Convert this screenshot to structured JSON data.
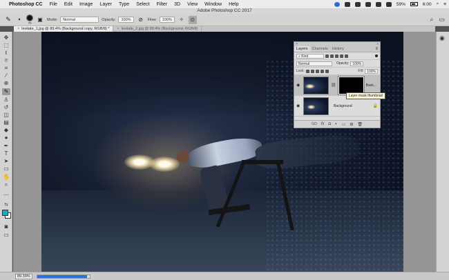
{
  "menubar": {
    "app_name": "Photoshop CC",
    "items": [
      "File",
      "Edit",
      "Image",
      "Layer",
      "Type",
      "Select",
      "Filter",
      "3D",
      "View",
      "Window",
      "Help"
    ],
    "battery": "59%",
    "clock": "6:00"
  },
  "window": {
    "title": "Adobe Photoshop CC 2017"
  },
  "options": {
    "brush_size": "70",
    "mode_label": "Mode:",
    "mode_value": "Normal",
    "opacity_label": "Opacity:",
    "opacity_value": "100%",
    "flow_label": "Flow:",
    "flow_value": "100%"
  },
  "tabs": [
    {
      "label": "levitate_1.jpg @ 89.4% (Background copy, RGB/8) *",
      "active": true
    },
    {
      "label": "levitate_2.jpg @ 89.4% (Background, RGB/8)",
      "active": false
    }
  ],
  "layers_panel": {
    "tabs": [
      "Layers",
      "Channels",
      "History"
    ],
    "filter_value": "Kind",
    "blend_value": "Normal",
    "opacity_label": "Opacity:",
    "opacity_value": "100%",
    "lock_label": "Lock:",
    "fill_label": "Fill:",
    "fill_value": "100%",
    "layers": [
      {
        "name": "Back...",
        "selected": true
      },
      {
        "name": "Background",
        "selected": false
      }
    ],
    "footer": [
      "GO",
      "fx"
    ]
  },
  "tooltip": "Layer mask thumbnail",
  "status": {
    "zoom": "89.39%",
    "progress": 0.95
  },
  "colors": {
    "foreground": "#1fa9c9",
    "background": "#ffffff",
    "accent": "#2f6fe0"
  }
}
